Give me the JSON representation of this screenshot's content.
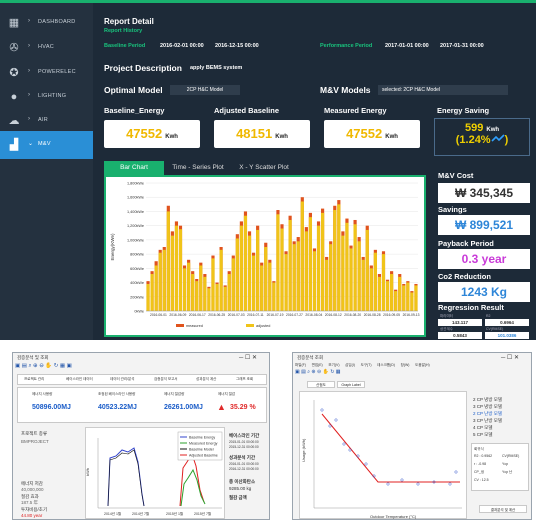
{
  "sidebar": {
    "items": [
      {
        "icon": "▦",
        "label": "DASHBOARD"
      },
      {
        "icon": "✇",
        "label": "HVAC"
      },
      {
        "icon": "✪",
        "label": "POWERELEC"
      },
      {
        "icon": "●",
        "label": "LIGHTING"
      },
      {
        "icon": "☁",
        "label": "AIR"
      },
      {
        "icon": "▟",
        "label": "M&V"
      }
    ]
  },
  "report": {
    "title": "Report Detail",
    "history": "Report History",
    "baseline_label": "Baseline Period",
    "baseline_start": "2016-02-01 00:00",
    "baseline_end": "2016-12-15 00:00",
    "performance_label": "Performance Period",
    "performance_start": "2017-01-01 00:00",
    "performance_end": "2017-01-31 00:00",
    "project_label": "Project Description",
    "project_value": "apply BEMS system",
    "optimal_label": "Optimal Model",
    "optimal_value": "2CP H&C Model",
    "mv_label": "M&V Models",
    "mv_value": "selected: 2CP H&C Model"
  },
  "kpis": {
    "baseline_title": "Baseline_Energy",
    "baseline_value": "47552",
    "adjusted_title": "Adjusted Baseline",
    "adjusted_value": "48151",
    "measured_title": "Measured Energy",
    "measured_value": "47552",
    "unit": "Kwh",
    "saving_title": "Energy Saving",
    "saving_value": "599",
    "saving_pct": "(1.24%",
    "saving_tail": ")"
  },
  "tabs": [
    "Bar Chart",
    "Time - Series Plot",
    "X - Y Scatter Plot"
  ],
  "metrics": {
    "mv_cost_label": "M&V Cost",
    "mv_cost_value": "₩ 345,345",
    "savings_label": "Savings",
    "savings_value": "₩ 899,521",
    "payback_label": "Payback Period",
    "payback_value": "0.3 year",
    "co2_label": "Co2 Reduction",
    "co2_value": "1243 Kg",
    "regression_label": "Regression Result",
    "reg_small": [
      "파라미터",
      "R2",
      "상관계수",
      "CV(RMSE)"
    ],
    "reg_values": [
      "143.117",
      "0.6964",
      "0.5843",
      "101.0386"
    ]
  },
  "chart_data": {
    "type": "bar",
    "ylabel": "Energy(KWe)",
    "ylim": [
      0,
      1800
    ],
    "yticks": [
      "0kWe",
      "200kWe",
      "400kWe",
      "600kWe",
      "800kWe",
      "1,000kWe",
      "1,200kWe",
      "1,400kWe",
      "1,600kWe",
      "1,800kWe"
    ],
    "xticks": [
      "2016-06-01",
      "2016-06-09",
      "2016-06-17",
      "2016-06-25",
      "2016-07-03",
      "2016-07-11",
      "2016-07-19",
      "2016-07-27",
      "2016-08-04",
      "2016-08-12",
      "2016-08-20",
      "2016-08-28",
      "2016-09-05",
      "2016-09-13"
    ],
    "series": [
      {
        "name": "measured",
        "color": "#e0531d",
        "values": [
          420,
          560,
          700,
          860,
          900,
          1480,
          1120,
          1260,
          1200,
          640,
          720,
          560,
          450,
          680,
          520,
          340,
          780,
          400,
          900,
          360,
          560,
          780,
          1080,
          1260,
          1400,
          1120,
          820,
          1200,
          680,
          960,
          720,
          420,
          1420,
          1220,
          840,
          1340,
          980,
          1040,
          1600,
          1180,
          1380,
          880,
          1260,
          1440,
          760,
          980,
          1480,
          1560,
          1120,
          1300,
          920,
          1280,
          1040,
          760,
          1200,
          640,
          860,
          520,
          840,
          440,
          560,
          300,
          520,
          380,
          420,
          280,
          380
        ]
      },
      {
        "name": "adjusted",
        "color": "#f0c419",
        "values": [
          380,
          520,
          640,
          820,
          860,
          1400,
          1060,
          1200,
          1150,
          600,
          680,
          520,
          420,
          640,
          480,
          320,
          740,
          380,
          860,
          340,
          520,
          740,
          1020,
          1200,
          1340,
          1060,
          780,
          1140,
          640,
          900,
          680,
          400,
          1360,
          1160,
          800,
          1280,
          940,
          980,
          1540,
          1120,
          1320,
          840,
          1200,
          1380,
          720,
          940,
          1420,
          1500,
          1060,
          1240,
          880,
          1220,
          980,
          720,
          1140,
          600,
          820,
          480,
          800,
          420,
          520,
          280,
          480,
          360,
          400,
          260,
          360
        ]
      }
    ]
  },
  "bottom_left": {
    "title": "검증분석 및 조회",
    "buttons": [
      "프로젝트 관리",
      "베이스라인 데이터",
      "데이터 관리/분석",
      "검증분석 보고서",
      "성과분석 계산",
      "그래프 조회"
    ],
    "kpi_labels": [
      "에너지 사용량",
      "조정된 베이스라인 사용량",
      "에너지 절감량",
      "에너지 절감"
    ],
    "kpi_values": [
      "50896.00MJ",
      "40523.22MJ",
      "26261.00MJ",
      "35.29 %"
    ],
    "side_labels": [
      "프로젝트 종류",
      "BMPROJECT",
      "에너지 저감",
      "40,000,000",
      "절감 효과",
      "187.5 年",
      "투자비용/초기",
      "44.80 year"
    ],
    "legend": [
      "Baseline Energy",
      "Measured Energy",
      "Baseline Model",
      "Adjusted Baseline"
    ],
    "right_labels": [
      "베이스라인 기간",
      "2015-01-01 00:00:00",
      "2015-12-31 00:00:00",
      "성과분석 기간",
      "2016-01-01 00:00:00",
      "2016-12-31 00:00:00",
      "총 이산화탄소",
      "9285.00 kg",
      "절감 금액"
    ],
    "ylabel": "kWh",
    "xticks": [
      "2014년 1월",
      "2014년 7월",
      "2015년 1월",
      "2015년 7월"
    ]
  },
  "bottom_right": {
    "title": "검증분석 조회",
    "menu": [
      "파일(F)",
      "편집(E)",
      "보기(V)",
      "삽입(I)",
      "도구(T)",
      "데스크톱(D)",
      "창(W)",
      "도움말(H)"
    ],
    "tabs": [
      "산점도",
      "Graph Label"
    ],
    "options": [
      "2 CP 냉방 모델",
      "3 CP 냉방 모델",
      "2 CP 난방 모델",
      "3 CP 난방 모델",
      "4 CP 모델",
      "5 CP 모델"
    ],
    "params": [
      "회귀식",
      "R2 : 0.9562",
      "CV(RMSE)",
      "r : -0.98",
      "Ycp",
      "CP_냉",
      "Ycp 난",
      "CV : 12.5"
    ],
    "xlabel": "Outdoor Temperature (°C)",
    "ylabel": "Usage (kWh)",
    "button": "결과분석 및 계산"
  }
}
